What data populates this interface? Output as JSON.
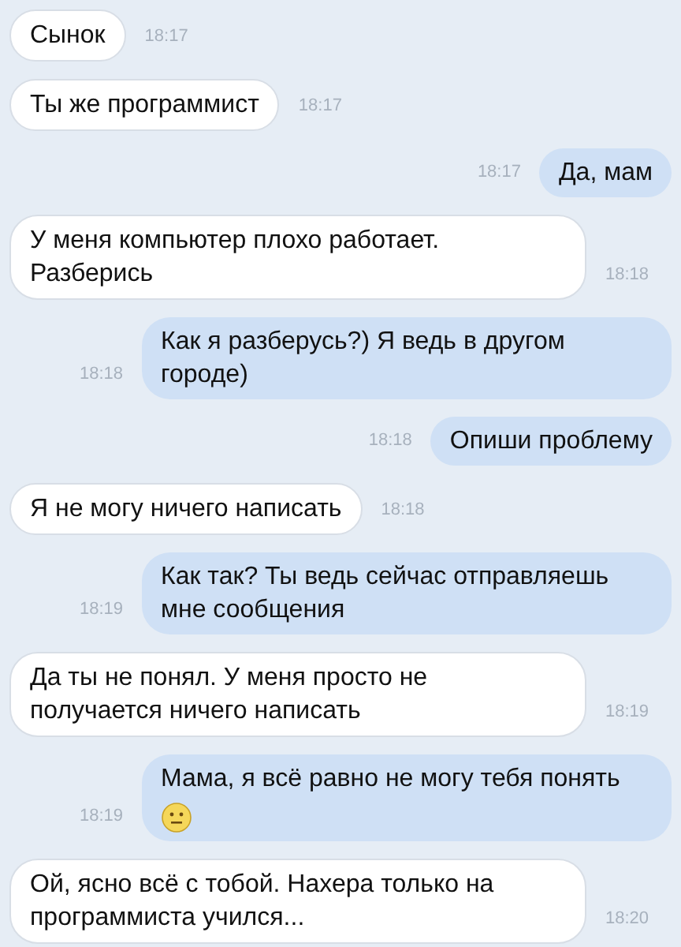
{
  "messages": [
    {
      "kind": "incoming",
      "text": "Сынок",
      "time": "18:17",
      "wide": false
    },
    {
      "kind": "incoming",
      "text": "Ты же программист",
      "time": "18:17",
      "wide": false
    },
    {
      "kind": "outgoing",
      "text": "Да, мам",
      "time": "18:17",
      "wide": false
    },
    {
      "kind": "incoming",
      "text": "У меня компьютер плохо работает.\nРазберись",
      "time": "18:18",
      "wide": true
    },
    {
      "kind": "outgoing",
      "text": "Как я разберусь?) Я ведь в другом\nгороде)",
      "time": "18:18",
      "wide": true
    },
    {
      "kind": "outgoing",
      "text": "Опиши проблему",
      "time": "18:18",
      "wide": false
    },
    {
      "kind": "incoming",
      "text": "Я не могу ничего написать",
      "time": "18:18",
      "wide": false
    },
    {
      "kind": "outgoing",
      "text": "Как так? Ты ведь сейчас отправляешь\nмне сообщения",
      "time": "18:19",
      "wide": true
    },
    {
      "kind": "incoming",
      "text": "Да ты не понял. У меня просто не\nполучается ничего написать",
      "time": "18:19",
      "wide": true
    },
    {
      "kind": "outgoing",
      "text": "Мама, я всё равно не могу тебя понять",
      "time": "18:19",
      "wide": true,
      "emoji": true
    },
    {
      "kind": "incoming",
      "text": "Ой, ясно всё с тобой. Нахера только на\nпрограммиста учился...",
      "time": "18:20",
      "wide": true
    }
  ]
}
